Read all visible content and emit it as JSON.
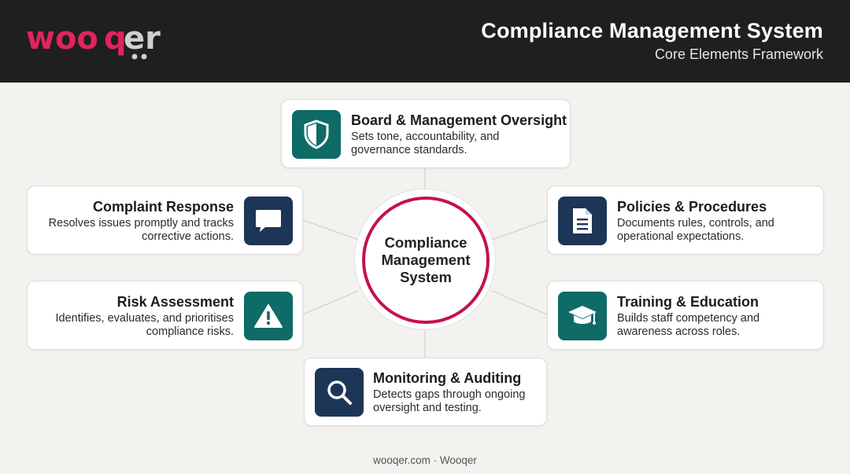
{
  "header": {
    "logo_text": "wooqer",
    "title": "Compliance Management System",
    "subtitle": "Core Elements Framework"
  },
  "hub": {
    "label": "Compliance Management System"
  },
  "nodes": [
    {
      "title": "Board & Management Oversight",
      "desc": "Sets tone, accountability, and governance standards.",
      "icon": "shield-icon"
    },
    {
      "title": "Policies & Procedures",
      "desc": "Documents rules, controls, and operational expectations.",
      "icon": "document-icon"
    },
    {
      "title": "Training & Education",
      "desc": "Builds staff competency and awareness across roles.",
      "icon": "graduation-cap-icon"
    },
    {
      "title": "Monitoring & Auditing",
      "desc": "Detects gaps through ongoing oversight and testing.",
      "icon": "magnifier-icon"
    },
    {
      "title": "Risk Assessment",
      "desc": "Identifies, evaluates, and prioritises compliance risks.",
      "icon": "warning-icon"
    },
    {
      "title": "Complaint Response",
      "desc": "Resolves issues promptly and tracks corrective actions.",
      "icon": "chat-bubble-icon"
    }
  ],
  "colors": {
    "teal": "#0e6b66",
    "navy": "#1d3557",
    "accent": "#c4124a",
    "logo_pink": "#e0245e"
  },
  "footer": {
    "text": "wooqer.com · Wooqer"
  }
}
